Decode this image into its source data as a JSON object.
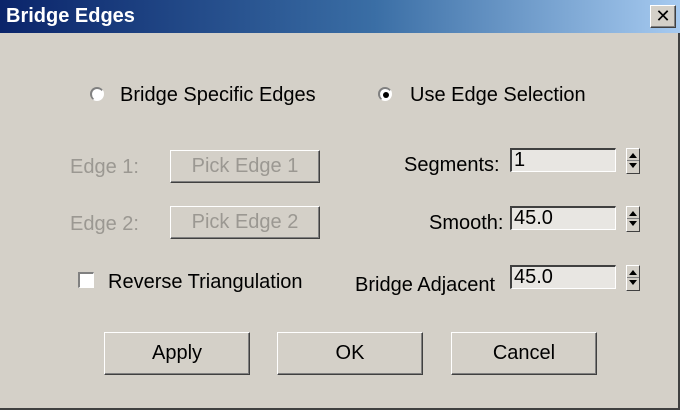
{
  "window": {
    "title": "Bridge Edges",
    "close_glyph": "✕"
  },
  "mode": {
    "options": [
      {
        "label": "Bridge Specific Edges",
        "selected": false
      },
      {
        "label": "Use Edge Selection",
        "selected": true
      }
    ]
  },
  "edges": {
    "edge1_label": "Edge 1:",
    "edge1_button": "Pick Edge 1",
    "edge2_label": "Edge 2:",
    "edge2_button": "Pick Edge 2"
  },
  "reverse_triangulation": {
    "label": "Reverse Triangulation",
    "checked": false
  },
  "params": {
    "segments_label": "Segments:",
    "segments_value": "1",
    "smooth_label": "Smooth:",
    "smooth_value": "45.0",
    "bridge_adjacent_label": "Bridge Adjacent",
    "bridge_adjacent_value": "45.0"
  },
  "buttons": {
    "apply": "Apply",
    "ok": "OK",
    "cancel": "Cancel"
  },
  "colors": {
    "title_gradient_start": "#0a246a",
    "title_gradient_end": "#a6caf0",
    "face": "#d4d0c8",
    "disabled_text": "#9b9892"
  }
}
